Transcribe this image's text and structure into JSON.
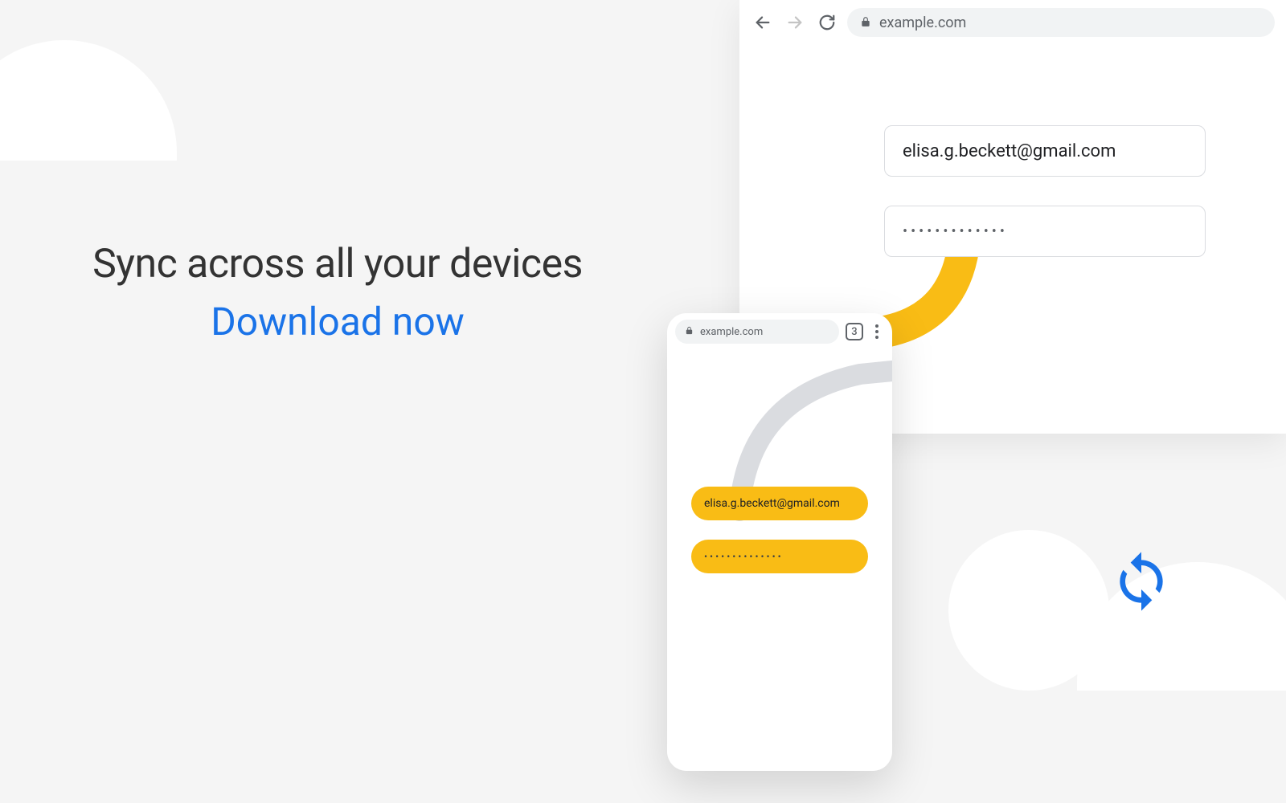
{
  "headline": {
    "title": "Sync across all your devices",
    "cta": "Download now"
  },
  "desktop": {
    "url": "example.com",
    "email": "elisa.g.beckett@gmail.com",
    "password_mask": "•••••••••••••"
  },
  "phone": {
    "url": "example.com",
    "tab_count": "3",
    "email": "elisa.g.beckett@gmail.com",
    "password_mask": "••••••••••••••"
  },
  "colors": {
    "accent_blue": "#1a73e8",
    "accent_yellow": "#f9bc15"
  }
}
